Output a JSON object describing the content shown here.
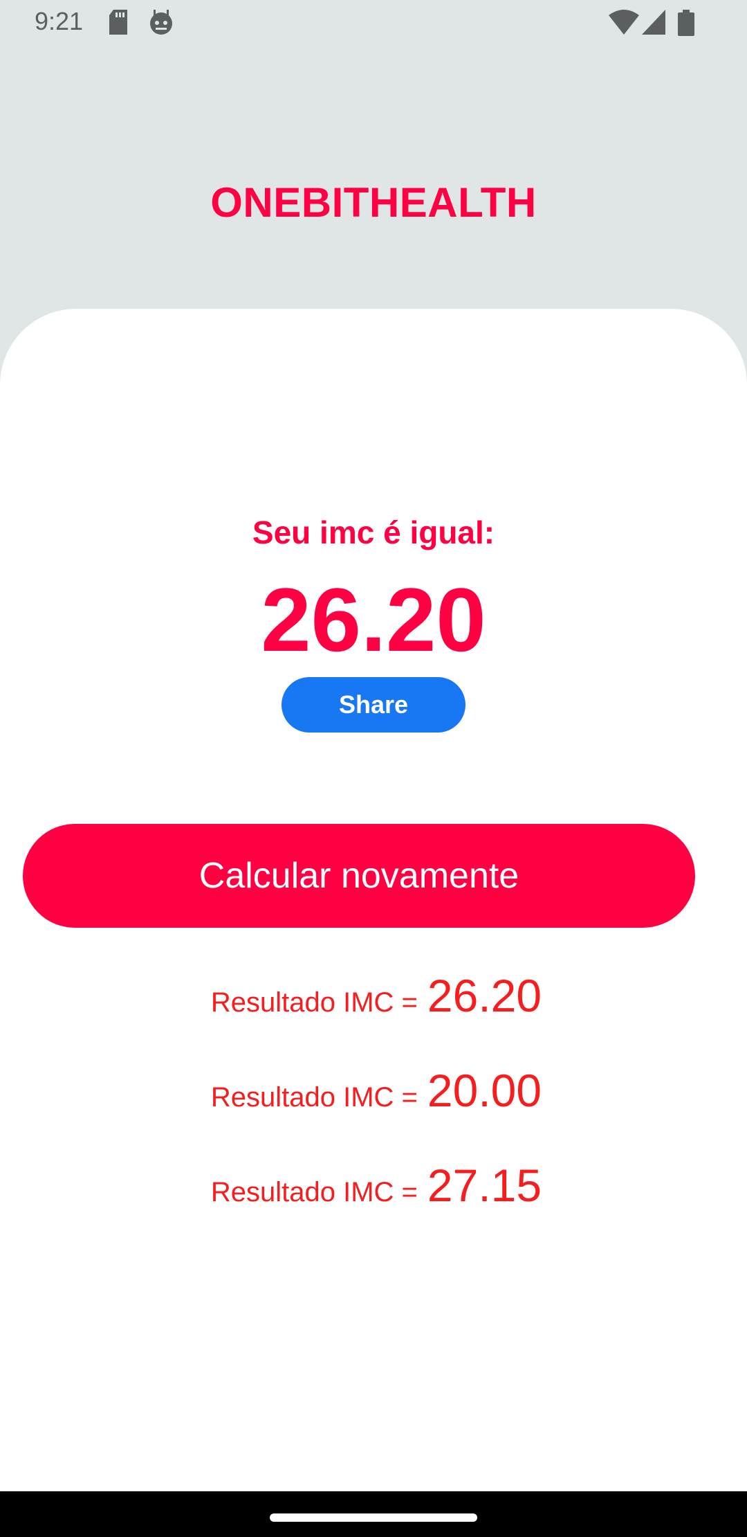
{
  "status_bar": {
    "time": "9:21",
    "left_icons": [
      "sd-card-icon",
      "android-debug-icon"
    ],
    "right_icons": [
      "wifi-icon",
      "cellular-signal-icon",
      "battery-icon"
    ]
  },
  "header": {
    "title": "ONEBITHEALTH"
  },
  "result": {
    "label": "Seu imc é igual:",
    "value": "26.20",
    "share_label": "Share"
  },
  "actions": {
    "recalculate_label": "Calcular novamente"
  },
  "results_list": [
    {
      "label": "Resultado IMC =",
      "value": "26.20"
    },
    {
      "label": "Resultado IMC =",
      "value": "20.00"
    },
    {
      "label": "Resultado IMC =",
      "value": "27.15"
    }
  ],
  "colors": {
    "accent": "#ff0043",
    "share_button": "#1877f2",
    "list_text": "#f51d1d",
    "header_background": "#e0e5e5"
  }
}
